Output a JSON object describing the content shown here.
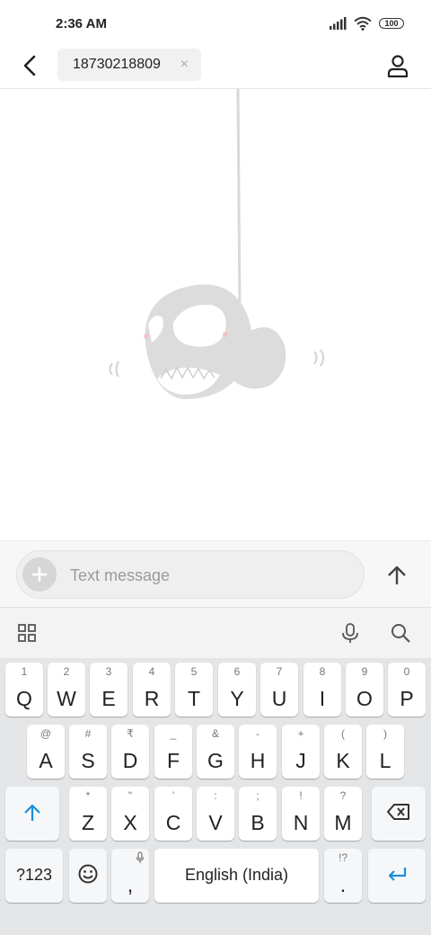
{
  "status_bar": {
    "time": "2:36 AM",
    "battery": "100"
  },
  "header": {
    "recipient": "18730218809",
    "chip_close": "×"
  },
  "compose": {
    "placeholder": "Text message"
  },
  "keyboard": {
    "row1": [
      {
        "hint": "1",
        "label": "Q"
      },
      {
        "hint": "2",
        "label": "W"
      },
      {
        "hint": "3",
        "label": "E"
      },
      {
        "hint": "4",
        "label": "R"
      },
      {
        "hint": "5",
        "label": "T"
      },
      {
        "hint": "6",
        "label": "Y"
      },
      {
        "hint": "7",
        "label": "U"
      },
      {
        "hint": "8",
        "label": "I"
      },
      {
        "hint": "9",
        "label": "O"
      },
      {
        "hint": "0",
        "label": "P"
      }
    ],
    "row2": [
      {
        "hint": "@",
        "label": "A"
      },
      {
        "hint": "#",
        "label": "S"
      },
      {
        "hint": "₹",
        "label": "D"
      },
      {
        "hint": "_",
        "label": "F"
      },
      {
        "hint": "&",
        "label": "G"
      },
      {
        "hint": "-",
        "label": "H"
      },
      {
        "hint": "+",
        "label": "J"
      },
      {
        "hint": "(",
        "label": "K"
      },
      {
        "hint": ")",
        "label": "L"
      }
    ],
    "row3": [
      {
        "hint": "*",
        "label": "Z"
      },
      {
        "hint": "\"",
        "label": "X"
      },
      {
        "hint": "'",
        "label": "C"
      },
      {
        "hint": ":",
        "label": "V"
      },
      {
        "hint": ";",
        "label": "B"
      },
      {
        "hint": "!",
        "label": "N"
      },
      {
        "hint": "?",
        "label": "M"
      }
    ],
    "symbols": "?123",
    "comma": ",",
    "space": "English (India)",
    "period": ".",
    "period_hint": "!?"
  },
  "colors": {
    "accent": "#1a8fd6",
    "key_bg": "#ffffff",
    "keyboard_bg": "#e4e5e7"
  }
}
